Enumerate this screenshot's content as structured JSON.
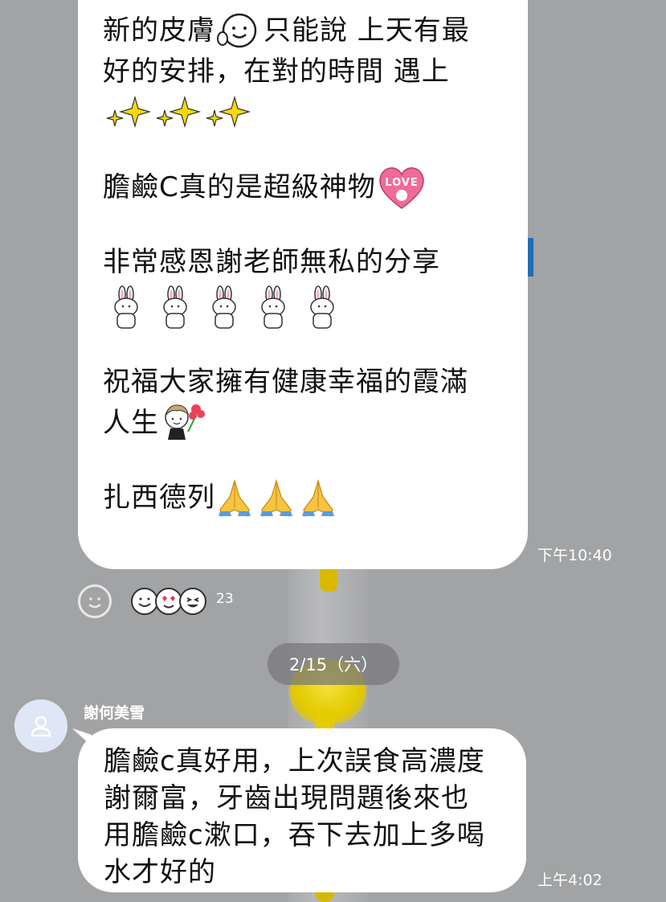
{
  "messages": [
    {
      "lines_a": [
        "新的皮膚",
        "只能說 上天有最"
      ],
      "line_2": "好的安排，在對的時間 遇上",
      "line_4": "膽鹼C真的是超級神物",
      "line_5": "非常感恩謝老師無私的分享",
      "line_7": "祝福大家擁有健康幸福的霞滿",
      "line_8": "人生",
      "line_9": "扎西德列",
      "time": "下午10:40",
      "reactions": {
        "count": "23"
      }
    },
    {
      "sender": "謝何美雪",
      "lines": [
        "膽鹼c真好用，上次誤食高濃度",
        "謝爾富，牙齒出現問題後來也",
        "用膽鹼c漱口，吞下去加上多喝",
        "水才好的"
      ],
      "time": "上午4:02"
    }
  ],
  "date_separator": "2/15（六）",
  "colors": {
    "background": "#a2a3a5",
    "bubble": "#ffffff",
    "avatar_bg": "#dfe6f5"
  },
  "icons": [
    "smile-sticker-icon",
    "sparkle-icon",
    "love-heart-icon",
    "bunny-sticker-icon",
    "girl-flower-sticker-icon",
    "praying-hands-icon",
    "add-reaction-icon",
    "reaction-emoji-icon",
    "default-avatar-icon"
  ]
}
